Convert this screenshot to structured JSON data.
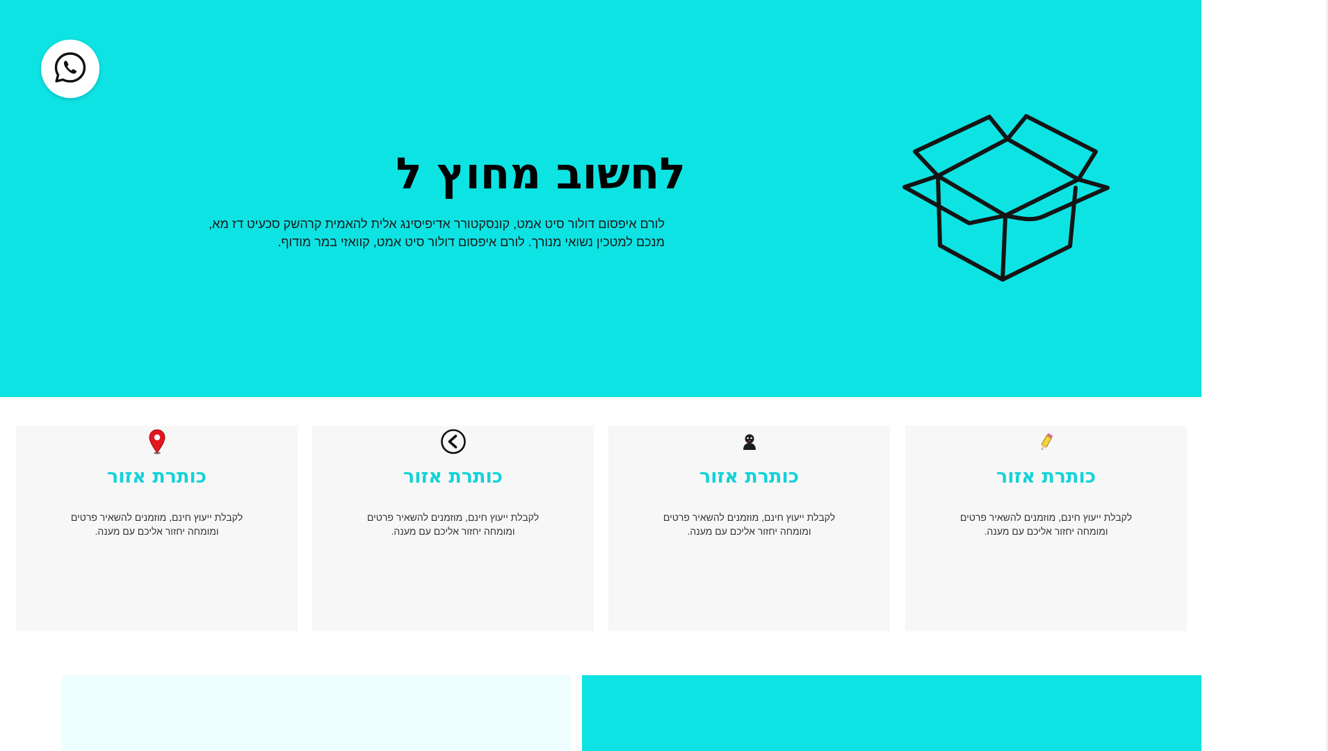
{
  "colors": {
    "accent": "#0ee3e3",
    "card_title": "#12d3d8",
    "card_background": "#f7f7f7",
    "bottom_left_panel": "#effefe"
  },
  "floating": {
    "whatsapp_icon": "whatsapp-icon"
  },
  "hero": {
    "title": "לחשוב מחוץ ל",
    "text": "לורם איפסום דולור סיט אמט, קונסקטורר אדיפיסינג אלית להאמית קרהשק סכעיט דז מא, מנכם למטכין נשואי מנורך. לורם איפסום דולור סיט אמט, קוואזי במר מודוף.",
    "illustration": "open-box-illustration"
  },
  "cards": [
    {
      "icon": "pencil-icon",
      "title": "כותרת אזור",
      "text": "לקבלת ייעוץ חינם, מוזמנים להשאיר פרטים ומומחה יחזור אליכם עם מענה."
    },
    {
      "icon": "person-icon",
      "title": "כותרת אזור",
      "text": "לקבלת ייעוץ חינם, מוזמנים להשאיר פרטים ומומחה יחזור אליכם עם מענה."
    },
    {
      "icon": "arrow-left-circle-icon",
      "title": "כותרת אזור",
      "text": "לקבלת ייעוץ חינם, מוזמנים להשאיר פרטים ומומחה יחזור אליכם עם מענה."
    },
    {
      "icon": "map-pin-icon",
      "title": "כותרת אזור",
      "text": "לקבלת ייעוץ חינם, מוזמנים להשאיר פרטים ומומחה יחזור אליכם עם מענה."
    }
  ]
}
